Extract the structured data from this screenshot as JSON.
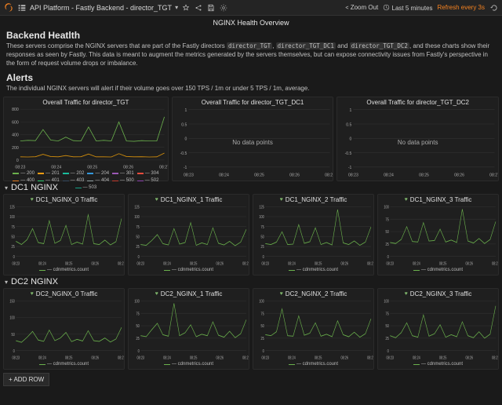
{
  "topbar": {
    "title": "API Platform - Fastly Backend - director_TGT",
    "zoom_out": "Zoom Out",
    "time_range": "Last 5 minutes",
    "refresh": "Refresh every 3s"
  },
  "overview": {
    "page_title": "NGINX Health Overview",
    "backend_health_h": "Backend Heatlth",
    "backend_health_p1a": "These servers comprise the NGINX servers that are part of the Fastly directors ",
    "backend_health_p1b": ", and these charts show their responses as seen by Fastly. This data is meant to augment the metrics generated by the servers themselves, but can expose connectivity issues from Fastly's perspective in the form of request volume drops or imbalance.",
    "dir1": "director_TGT",
    "dir2": "director_TGT_DC1",
    "dir3": "director_TGT_DC2",
    "sep_and": " and ",
    "alerts_h": "Alerts",
    "alerts_p": "The individual NGINX servers will alert if their volume goes over 150 TPS / 1m or under 5 TPS / 1m, average."
  },
  "row_labels": {
    "dc1": "DC1 NGINX",
    "dc2": "DC2 NGINX"
  },
  "buttons": {
    "add_row": "+ ADD ROW"
  },
  "legend_metric": "cdnmetrics.count",
  "no_data": "No data points",
  "chart_data": {
    "overall": [
      {
        "title": "Overall Traffic for director_TGT",
        "type": "line",
        "xticks": [
          "08:23",
          "08:24",
          "08:25",
          "08:26",
          "08:27"
        ],
        "ylim": [
          0,
          800
        ],
        "yticks": [
          0,
          200,
          400,
          600,
          800
        ],
        "legend": [
          {
            "name": "200",
            "color": "#6ab04c"
          },
          {
            "name": "201",
            "color": "#f39c12"
          },
          {
            "name": "202",
            "color": "#1abc9c"
          },
          {
            "name": "204",
            "color": "#3498db"
          },
          {
            "name": "301",
            "color": "#9b59b6"
          },
          {
            "name": "304",
            "color": "#e74c3c"
          },
          {
            "name": "400",
            "color": "#e67e22"
          },
          {
            "name": "401",
            "color": "#2ecc71"
          },
          {
            "name": "403",
            "color": "#34495e"
          },
          {
            "name": "404",
            "color": "#95a5a6"
          },
          {
            "name": "500",
            "color": "#c0392b"
          },
          {
            "name": "502",
            "color": "#8e44ad"
          },
          {
            "name": "503",
            "color": "#16a085"
          }
        ],
        "series": [
          {
            "name": "200",
            "color": "#6ab04c",
            "values": [
              300,
              310,
              305,
              480,
              315,
              300,
              360,
              305,
              300,
              520,
              300,
              310,
              300,
              600,
              300,
              295,
              305,
              300,
              300,
              680
            ]
          },
          {
            "name": "404",
            "color": "#d9920b",
            "values": [
              50,
              48,
              52,
              90,
              55,
              50,
              70,
              50,
              52,
              95,
              50,
              50,
              48,
              100,
              55,
              50,
              52,
              48,
              50,
              110
            ]
          }
        ]
      },
      {
        "title": "Overall Traffic for director_TGT_DC1",
        "type": "line",
        "xticks": [
          "08:23",
          "08:24",
          "08:25",
          "08:26",
          "08:27"
        ],
        "ylim": [
          -1.0,
          1.0
        ],
        "yticks": [
          -1.0,
          -0.5,
          0,
          0.5,
          1.0
        ],
        "nodata": true,
        "legend": [],
        "series": []
      },
      {
        "title": "Overall Traffic for director_TGT_DC2",
        "type": "line",
        "xticks": [
          "08:23",
          "08:24",
          "08:25",
          "08:26",
          "08:27"
        ],
        "ylim": [
          -1.0,
          1.0
        ],
        "yticks": [
          -1.0,
          -0.5,
          0,
          0.5,
          1.0
        ],
        "nodata": true,
        "legend": [],
        "series": []
      }
    ],
    "dc1": [
      {
        "title": "DC1_NGINX_0 Traffic",
        "type": "line",
        "xticks": [
          "08:23",
          "08:24",
          "08:25",
          "08:26",
          "08:27"
        ],
        "ylim": [
          0,
          125
        ],
        "yticks": [
          0,
          25,
          50,
          75,
          100,
          125
        ],
        "series": [
          {
            "name": "cdnmetrics.count",
            "color": "#6ab04c",
            "values": [
              38,
              30,
              42,
              70,
              35,
              32,
              90,
              33,
              40,
              78,
              30,
              36,
              31,
              105,
              32,
              30,
              41,
              29,
              37,
              95
            ]
          }
        ]
      },
      {
        "title": "DC1_NGINX_1 Traffic",
        "type": "line",
        "xticks": [
          "08:23",
          "08:24",
          "08:25",
          "08:26",
          "08:27"
        ],
        "ylim": [
          0,
          125
        ],
        "yticks": [
          0,
          25,
          50,
          75,
          100,
          125
        ],
        "series": [
          {
            "name": "cdnmetrics.count",
            "color": "#6ab04c",
            "values": [
              30,
              28,
              40,
              55,
              32,
              29,
              70,
              31,
              35,
              85,
              28,
              34,
              30,
              72,
              33,
              29,
              38,
              27,
              36,
              68
            ]
          }
        ]
      },
      {
        "title": "DC1_NGINX_2 Traffic",
        "type": "line",
        "xticks": [
          "08:23",
          "08:24",
          "08:25",
          "08:26",
          "08:27"
        ],
        "ylim": [
          0,
          125
        ],
        "yticks": [
          0,
          25,
          50,
          75,
          100,
          125
        ],
        "series": [
          {
            "name": "cdnmetrics.count",
            "color": "#6ab04c",
            "values": [
              32,
              30,
              36,
              62,
              30,
              31,
              80,
              33,
              37,
              72,
              30,
              35,
              29,
              118,
              34,
              30,
              39,
              28,
              36,
              74
            ]
          }
        ]
      },
      {
        "title": "DC1_NGINX_3 Traffic",
        "type": "line",
        "xticks": [
          "08:23",
          "08:24",
          "08:25",
          "08:26",
          "08:27"
        ],
        "ylim": [
          0,
          100
        ],
        "yticks": [
          0,
          25,
          50,
          75,
          100
        ],
        "series": [
          {
            "name": "cdnmetrics.count",
            "color": "#6ab04c",
            "values": [
              28,
              26,
              34,
              60,
              30,
              29,
              68,
              31,
              32,
              55,
              29,
              33,
              28,
              95,
              31,
              27,
              36,
              26,
              34,
              70
            ]
          }
        ]
      }
    ],
    "dc2": [
      {
        "title": "DC2_NGINX_0 Traffic",
        "type": "line",
        "xticks": [
          "08:23",
          "08:24",
          "08:25",
          "08:26",
          "08:27"
        ],
        "ylim": [
          0,
          150
        ],
        "yticks": [
          0,
          50,
          100,
          150
        ],
        "series": [
          {
            "name": "cdnmetrics.count",
            "color": "#6ab04c",
            "values": [
              30,
              25,
              40,
              58,
              32,
              28,
              62,
              30,
              38,
              55,
              27,
              34,
              29,
              60,
              30,
              28,
              38,
              26,
              35,
              70
            ]
          }
        ]
      },
      {
        "title": "DC2_NGINX_1 Traffic",
        "type": "line",
        "xticks": [
          "08:23",
          "08:24",
          "08:25",
          "08:26",
          "08:27"
        ],
        "ylim": [
          0,
          100
        ],
        "yticks": [
          0,
          25,
          50,
          75,
          100
        ],
        "series": [
          {
            "name": "cdnmetrics.count",
            "color": "#6ab04c",
            "values": [
              30,
              28,
              42,
              55,
              32,
              29,
              95,
              30,
              36,
              52,
              28,
              33,
              30,
              58,
              31,
              27,
              39,
              26,
              34,
              62
            ]
          }
        ]
      },
      {
        "title": "DC2_NGINX_2 Traffic",
        "type": "line",
        "xticks": [
          "08:23",
          "08:24",
          "08:25",
          "08:26",
          "08:27"
        ],
        "ylim": [
          0,
          100
        ],
        "yticks": [
          0,
          25,
          50,
          75,
          100
        ],
        "series": [
          {
            "name": "cdnmetrics.count",
            "color": "#6ab04c",
            "values": [
              32,
              30,
              38,
              84,
              30,
              29,
              70,
              31,
              35,
              56,
              29,
              33,
              28,
              60,
              32,
              28,
              37,
              27,
              34,
              64
            ]
          }
        ]
      },
      {
        "title": "DC2_NGINX_3 Traffic",
        "type": "line",
        "xticks": [
          "08:23",
          "08:24",
          "08:25",
          "08:26",
          "08:27"
        ],
        "ylim": [
          0,
          100
        ],
        "yticks": [
          0,
          25,
          50,
          75,
          100
        ],
        "series": [
          {
            "name": "cdnmetrics.count",
            "color": "#6ab04c",
            "values": [
              30,
              26,
              36,
              56,
              30,
              27,
              72,
              29,
              34,
              52,
              27,
              32,
              28,
              58,
              30,
              26,
              38,
              25,
              33,
              90
            ]
          }
        ]
      }
    ]
  }
}
